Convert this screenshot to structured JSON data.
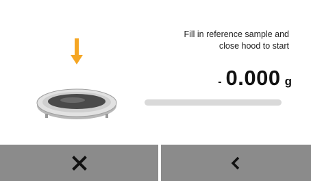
{
  "instruction": {
    "line1": "Fill in reference sample and",
    "line2": "close hood to start"
  },
  "reading": {
    "sign": "-",
    "value": "0.000",
    "unit": "g"
  },
  "progress": {
    "fraction": 0
  },
  "footer": {
    "cancel_icon": "close-x-icon",
    "back_icon": "chevron-left-icon"
  },
  "colors": {
    "arrow": "#f5a623",
    "button_bg": "#8b8b8b",
    "progress_track": "#d9d9d9"
  }
}
